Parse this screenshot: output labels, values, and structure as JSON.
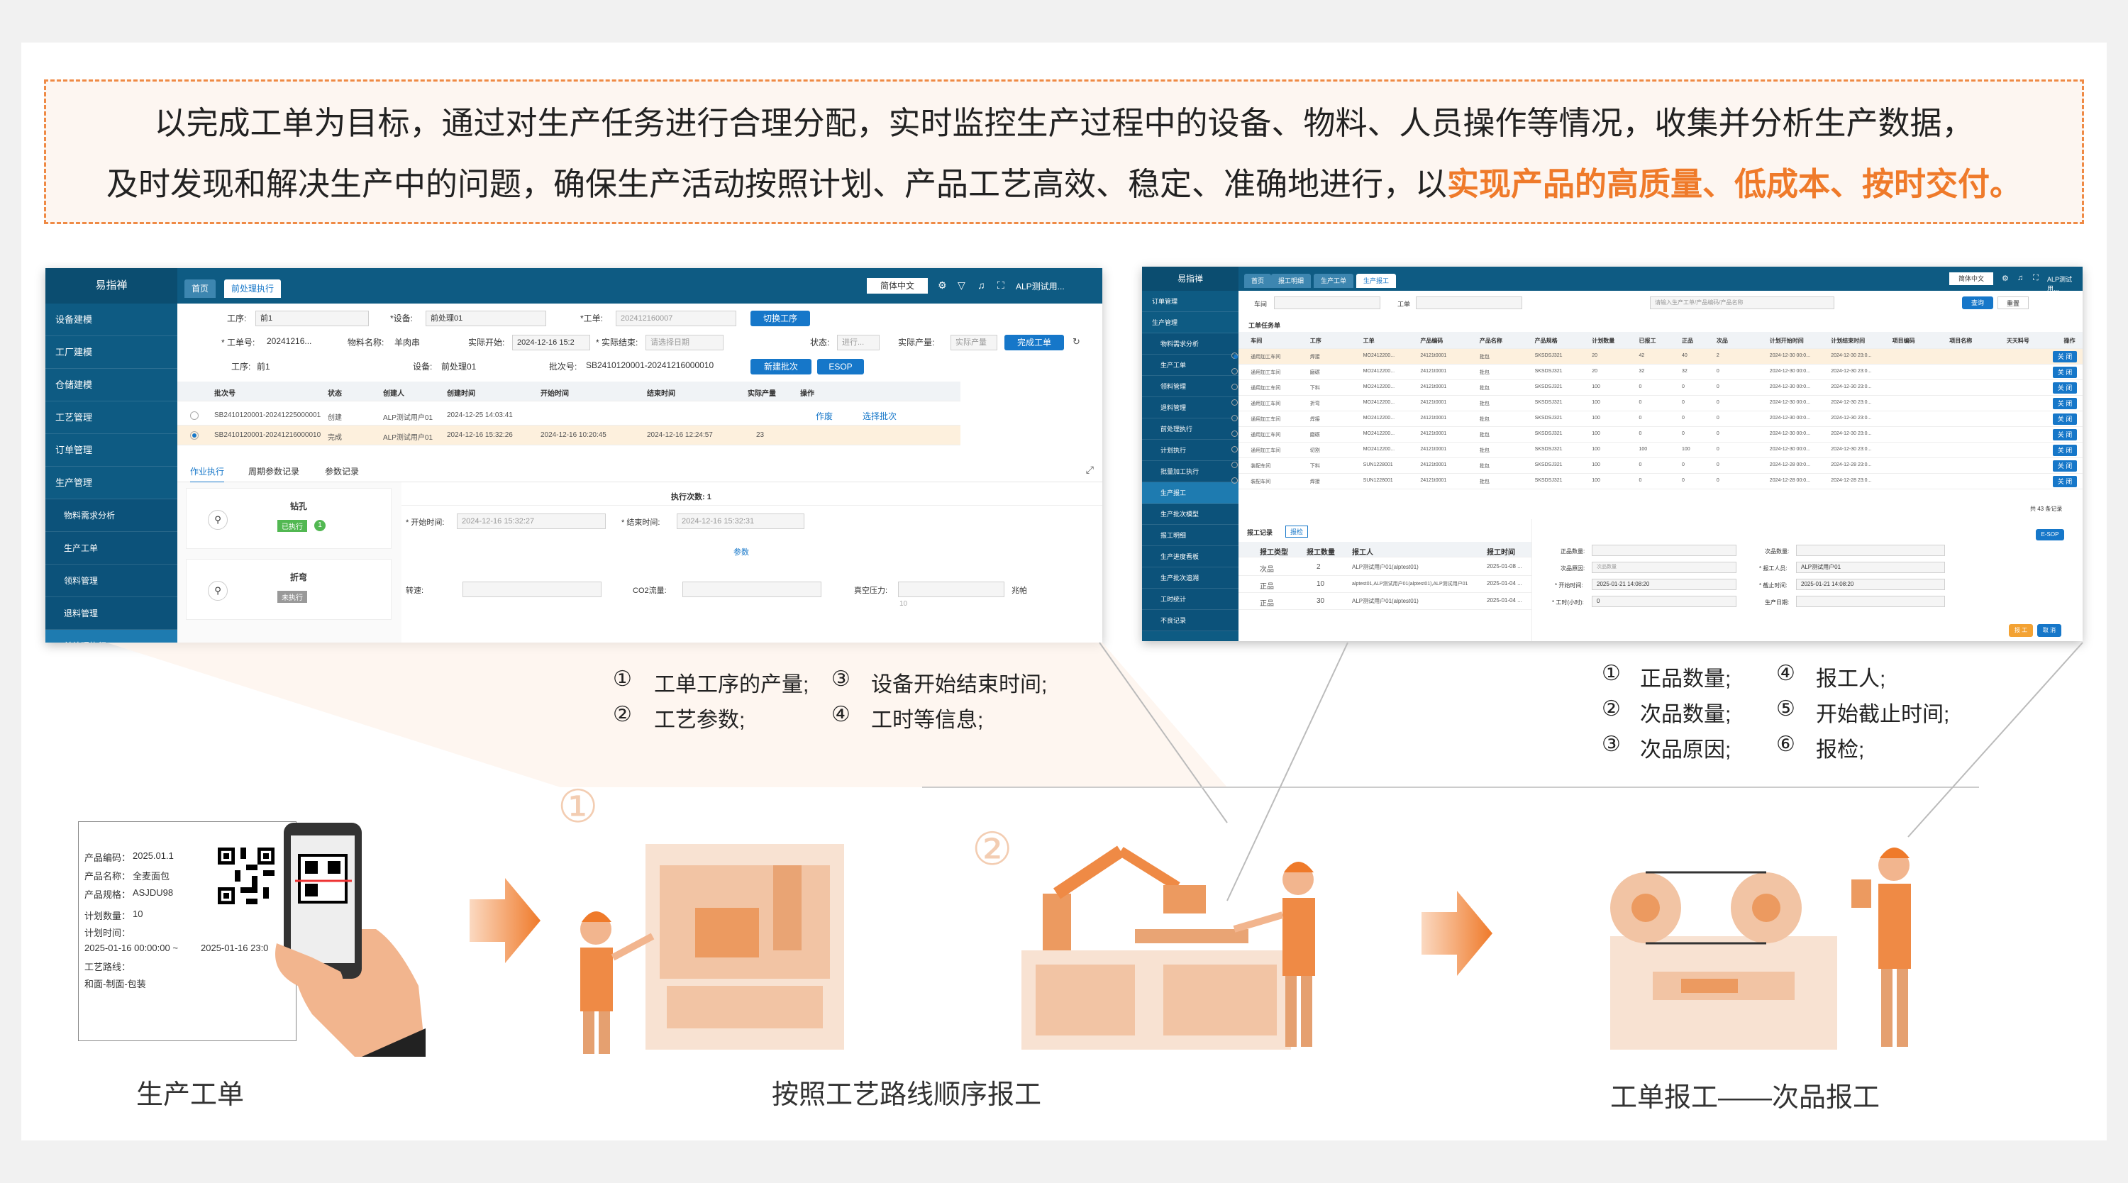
{
  "banner": {
    "line1": "以完成工单为目标，通过对生产任务进行合理分配，实时监控生产过程中的设备、物料、人员操作等情况，收集并分析生产数据，",
    "line2_prefix": "及时发现和解决生产中的问题，确保生产活动按照计划、产品工艺高效、稳定、准确地进行，以",
    "line2_highlight": "实现产品的高质量、低成本、按时交付。"
  },
  "left_app": {
    "logo": "易指禅",
    "menu": [
      {
        "label": "设备建模"
      },
      {
        "label": "工厂建模"
      },
      {
        "label": "仓储建模"
      },
      {
        "label": "工艺管理"
      },
      {
        "label": "订单管理"
      },
      {
        "label": "生产管理"
      },
      {
        "label": "物料需求分析"
      },
      {
        "label": "生产工单"
      },
      {
        "label": "领料管理"
      },
      {
        "label": "退料管理"
      },
      {
        "label": "前处理执行"
      }
    ],
    "tabs": [
      "首页",
      "前处理执行"
    ],
    "topright": {
      "lang": "简体中文",
      "user": "ALP测试用..."
    },
    "filters": {
      "process_label": "工序:",
      "process_value": "前1",
      "device_label": "*设备:",
      "device_value": "前处理01",
      "order_label": "*工单:",
      "order_value": "202412160007",
      "switch_btn": "切换工序",
      "order_no_label": "* 工单号:",
      "order_no_value": "20241216...",
      "material_label": "物料名称:",
      "material_value": "羊肉串",
      "start_label": "实际开始:",
      "start_value": "2024-12-16 15:2",
      "end_label": "* 实际结束:",
      "end_placeholder": "请选择日期",
      "status_label": "状态:",
      "status_value": "进行...",
      "qty_label": "实际产量:",
      "qty_placeholder": "实际产量",
      "finish_btn": "完成工单",
      "proc2_label": "工序:",
      "proc2_value": "前1",
      "dev2_label": "设备:",
      "dev2_value": "前处理01",
      "batch_label": "批次号:",
      "batch_value": "SB2410120001-20241216000010",
      "new_batch_btn": "新建批次",
      "esop_btn": "ESOP"
    },
    "table": {
      "headers": [
        "批次号",
        "状态",
        "创建人",
        "创建时间",
        "开始时间",
        "结束时间",
        "实际产量",
        "操作"
      ],
      "rows": [
        [
          "SB2410120001-20241225000001",
          "创建",
          "ALP测试用户01",
          "2024-12-25 14:03:41",
          "",
          "",
          ""
        ],
        [
          "SB2410120001-20241216000010",
          "完成",
          "ALP测试用户01",
          "2024-12-16 15:32:26",
          "2024-12-16 10:20:45",
          "2024-12-16 12:24:57",
          "23"
        ]
      ],
      "actions": [
        "作废",
        "选择批次"
      ]
    },
    "subtabs": [
      "作业执行",
      "周期参数记录",
      "参数记录"
    ],
    "steps": [
      {
        "name": "钻孔",
        "status": "已执行",
        "count": "1"
      },
      {
        "name": "折弯",
        "status": "未执行"
      }
    ],
    "exec": {
      "count_label": "执行次数: 1",
      "start_label": "* 开始时间:",
      "start_value": "2024-12-16 15:32:27",
      "end_label": "* 结束时间:",
      "end_value": "2024-12-16 15:32:31",
      "param_tab": "参数",
      "p1": "转速:",
      "p2": "CO2流量:",
      "p3": "真空压力:",
      "unit": "兆帕",
      "p3_val": "10"
    }
  },
  "right_app": {
    "logo": "易指禅",
    "menu": [
      {
        "label": "订单管理"
      },
      {
        "label": "生产管理"
      },
      {
        "label": "物料需求分析"
      },
      {
        "label": "生产工单"
      },
      {
        "label": "领料管理"
      },
      {
        "label": "退料管理"
      },
      {
        "label": "前处理执行"
      },
      {
        "label": "计划执行"
      },
      {
        "label": "批量加工执行"
      },
      {
        "label": "生产报工"
      },
      {
        "label": "生产批次模型"
      },
      {
        "label": "报工明细"
      },
      {
        "label": "生产进度看板"
      },
      {
        "label": "生产批次追溯"
      },
      {
        "label": "工时统计"
      },
      {
        "label": "不良记录"
      }
    ],
    "tabs": [
      "首页",
      "报工明细",
      "生产工单",
      "生产报工"
    ],
    "topright": {
      "lang": "简体中文",
      "user": "ALP测试用..."
    },
    "filter": {
      "l1": "车间",
      "l2": "工单",
      "search_placeholder": "请输入生产工单/产品编码/产品名称",
      "search_btn": "查询",
      "reset_btn": "重置"
    },
    "list_title": "工单任务单",
    "headers": [
      "车间",
      "工序",
      "工单",
      "产品编码",
      "产品名称",
      "产品规格",
      "计划数量",
      "已报工",
      "正品",
      "次品",
      "计划开始时间",
      "计划结束时间",
      "项目编码",
      "项目名称",
      "天天料号",
      "操作"
    ],
    "rows": [
      [
        "通用加工车间",
        "焊接",
        "MO2412200...",
        "24121t0001",
        "批包",
        "SKSDSJ321",
        "20",
        "42",
        "40",
        "2",
        "2024-12-30 00:0...",
        "2024-12-30 23:0..."
      ],
      [
        "通用加工车间",
        "磨砺",
        "MO2412200...",
        "24121t0001",
        "批包",
        "SKSDSJ321",
        "20",
        "32",
        "32",
        "0",
        "2024-12-30 00:0...",
        "2024-12-30 23:0..."
      ],
      [
        "通用加工车间",
        "下料",
        "MO2412200...",
        "24121t0001",
        "批包",
        "SKSDSJ321",
        "100",
        "0",
        "0",
        "0",
        "2024-12-30 00:0...",
        "2024-12-30 23:0..."
      ],
      [
        "通用加工车间",
        "折弯",
        "MO2412200...",
        "24121t0001",
        "批包",
        "SKSDSJ321",
        "100",
        "0",
        "0",
        "0",
        "2024-12-30 00:0...",
        "2024-12-30 23:0..."
      ],
      [
        "通用加工车间",
        "焊接",
        "MO2412200...",
        "24121t0001",
        "批包",
        "SKSDSJ321",
        "100",
        "0",
        "0",
        "0",
        "2024-12-30 00:0...",
        "2024-12-30 23:0..."
      ],
      [
        "通用加工车间",
        "磨砺",
        "MO2412200...",
        "24121t0001",
        "批包",
        "SKSDSJ321",
        "100",
        "0",
        "0",
        "0",
        "2024-12-30 00:0...",
        "2024-12-30 23:0..."
      ],
      [
        "通用加工车间",
        "切割",
        "MO2412200...",
        "24121t0001",
        "批包",
        "SKSDSJ321",
        "100",
        "100",
        "100",
        "0",
        "2024-12-30 00:0...",
        "2024-12-30 23:0..."
      ],
      [
        "装配车间",
        "下料",
        "SUN1228001",
        "24121t0001",
        "批包",
        "SKSDSJ321",
        "100",
        "0",
        "0",
        "0",
        "2024-12-28 00:0...",
        "2024-12-28 23:0..."
      ],
      [
        "装配车间",
        "焊接",
        "SUN1228001",
        "24121t0001",
        "批包",
        "SKSDSJ321",
        "100",
        "0",
        "0",
        "0",
        "2024-12-28 00:0...",
        "2024-12-28 23:0..."
      ]
    ],
    "action": "关 闭",
    "pager": "共 43 条记录",
    "report": {
      "title": "报工记录",
      "btn": "报检",
      "headers": [
        "报工类型",
        "报工数量",
        "报工人",
        "报工时间"
      ],
      "rows": [
        [
          "次品",
          "2",
          "ALP测试用户01(alptest01)",
          "2025-01-08 ..."
        ],
        [
          "正品",
          "10",
          "alptest01,ALP测试用户01(alptest01),ALP测试用户01",
          "2025-01-04 ..."
        ],
        [
          "正品",
          "30",
          "ALP测试用户01(alptest01)",
          "2025-01-04 ..."
        ]
      ],
      "esop": "E-SOP",
      "f_good": "正品数量:",
      "f_bad": "次品数量:",
      "f_reason": "次品原因:",
      "f_reason_ph": "次品数量",
      "f_worker": "* 报工人员:",
      "f_worker_v": "ALP测试用户01",
      "f_start": "* 开始时间:",
      "f_start_v": "2025-01-21 14:08:20",
      "f_end": "* 截止时间:",
      "f_end_v": "2025-01-21 14:08:20",
      "f_hours": "* 工时(小时):",
      "f_hours_v": "0",
      "f_date": "生产日期:",
      "btn_report": "报 工",
      "btn_cancel": "取 消"
    }
  },
  "callouts_left": [
    "①",
    "工单工序的产量;",
    "③",
    "设备开始结束时间;",
    "②",
    "工艺参数;",
    "④",
    "工时等信息;"
  ],
  "callouts_right": [
    "①",
    "正品数量;",
    "④",
    "报工人;",
    "②",
    "次品数量;",
    "⑤",
    "开始截止时间;",
    "③",
    "次品原因;",
    "⑥",
    "报检;"
  ],
  "work_order_card": {
    "lines": [
      "产品编码：",
      "2025.01.1",
      "产品名称：",
      "全麦面包",
      "产品规格：",
      "ASJDU98",
      "计划数量：",
      "10",
      "计划时间：",
      "2025-01-16 00:00:00 ~",
      "2025-01-16 23:0",
      "工艺路线：",
      "和面-制面-包装"
    ]
  },
  "step_marks": [
    "①",
    "②"
  ],
  "captions": [
    "生产工单",
    "按照工艺路线顺序报工",
    "工单报工——次品报工"
  ],
  "colors": {
    "accent": "#ef7a2a",
    "primary": "#0e5b83",
    "button": "#1677c9",
    "illustration": "#f2c4a4"
  }
}
